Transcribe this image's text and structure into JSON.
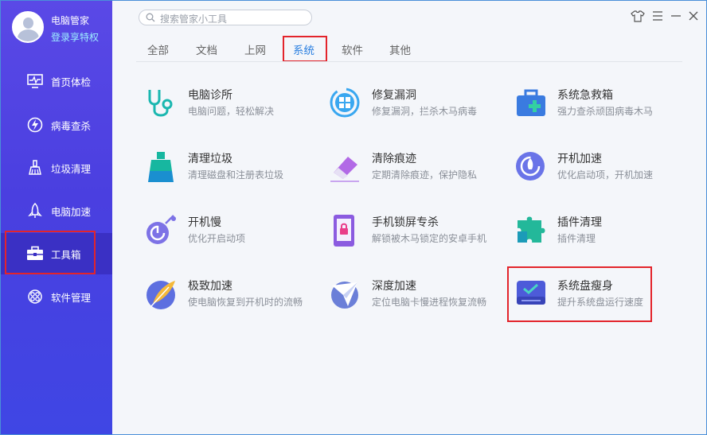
{
  "user": {
    "name": "电脑管家",
    "login_text": "登录享特权"
  },
  "sidebar": {
    "items": [
      {
        "label": "首页体检",
        "icon": "monitor-icon"
      },
      {
        "label": "病毒查杀",
        "icon": "lightning-shield-icon"
      },
      {
        "label": "垃圾清理",
        "icon": "broom-icon"
      },
      {
        "label": "电脑加速",
        "icon": "rocket-icon"
      },
      {
        "label": "工具箱",
        "icon": "toolbox-icon"
      },
      {
        "label": "软件管理",
        "icon": "apps-icon"
      }
    ],
    "active_index": 4
  },
  "search": {
    "placeholder": "搜索管家小工具"
  },
  "tabs": [
    {
      "label": "全部"
    },
    {
      "label": "文档"
    },
    {
      "label": "上网"
    },
    {
      "label": "系统"
    },
    {
      "label": "软件"
    },
    {
      "label": "其他"
    }
  ],
  "active_tab_index": 3,
  "tools": [
    {
      "name": "电脑诊所",
      "desc": "电脑问题，轻松解决",
      "icon": "stethoscope-icon"
    },
    {
      "name": "修复漏洞",
      "desc": "修复漏洞，拦杀木马病毒",
      "icon": "windows-repair-icon"
    },
    {
      "name": "系统急救箱",
      "desc": "强力查杀顽固病毒木马",
      "icon": "first-aid-kit-icon"
    },
    {
      "name": "清理垃圾",
      "desc": "清理磁盘和注册表垃圾",
      "icon": "broom-icon"
    },
    {
      "name": "清除痕迹",
      "desc": "定期清除痕迹，保护隐私",
      "icon": "eraser-icon"
    },
    {
      "name": "开机加速",
      "desc": "优化启动项，开机加速",
      "icon": "rocket-power-icon"
    },
    {
      "name": "开机慢",
      "desc": "优化开启动项",
      "icon": "power-slow-icon"
    },
    {
      "name": "手机锁屏专杀",
      "desc": "解锁被木马锁定的安卓手机",
      "icon": "phone-lock-icon"
    },
    {
      "name": "插件清理",
      "desc": "插件清理",
      "icon": "puzzle-icon"
    },
    {
      "name": "极致加速",
      "desc": "使电脑恢复到开机时的流畅",
      "icon": "feather-icon"
    },
    {
      "name": "深度加速",
      "desc": "定位电脑卡慢进程恢复流畅",
      "icon": "paper-plane-icon"
    },
    {
      "name": "系统盘瘦身",
      "desc": "提升系统盘运行速度",
      "icon": "disk-check-icon"
    }
  ],
  "colors": {
    "sidebar": "#4a3fe0",
    "active_tab": "#2a7fe0",
    "highlight": "#e3242b"
  }
}
